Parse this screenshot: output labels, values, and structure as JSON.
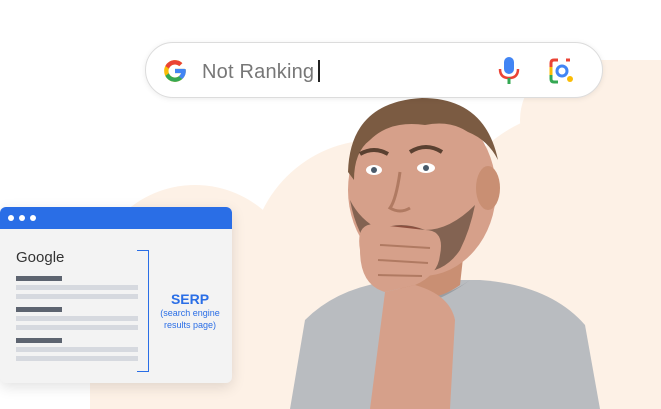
{
  "search": {
    "query": "Not Ranking",
    "icons": [
      "google-logo",
      "microphone-icon",
      "lens-camera-icon"
    ]
  },
  "browser": {
    "title": "Google",
    "serp_label": "SERP",
    "serp_sub_1": "(search engine",
    "serp_sub_2": "results page)"
  },
  "colors": {
    "brand_blue": "#2a6ee6",
    "peach": "#fdf1e6",
    "google_blue": "#4285F4",
    "google_red": "#EA4335",
    "google_yellow": "#FBBC05",
    "google_green": "#34A853"
  }
}
